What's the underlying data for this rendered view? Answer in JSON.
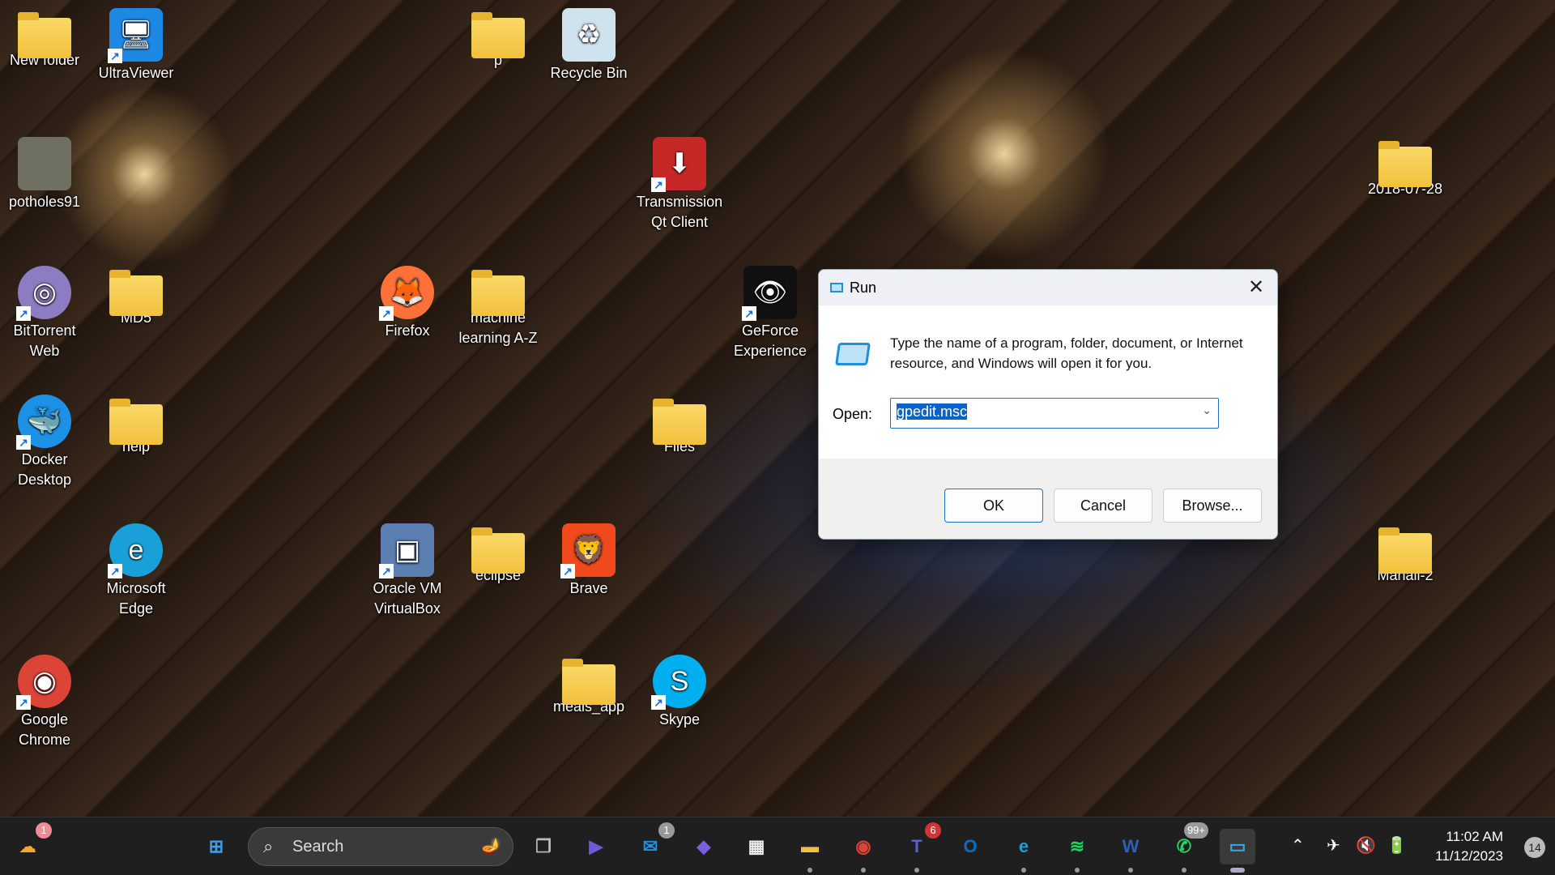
{
  "desktop": {
    "icons": [
      {
        "label": "New folder",
        "type": "folder",
        "col": 0,
        "row": 0
      },
      {
        "label": "UltraViewer",
        "type": "app",
        "icon": "ultraviewer-icon",
        "color": "#1e88e5",
        "glyph": "🖥",
        "shortcut": true,
        "col": 1,
        "row": 0
      },
      {
        "label": "p",
        "type": "folder",
        "col": 4,
        "row": 0
      },
      {
        "label": "Recycle Bin",
        "type": "app",
        "icon": "recycle-bin-icon",
        "color": "#cfe3ef",
        "glyph": "♻",
        "col": 5,
        "row": 0
      },
      {
        "label": "potholes91",
        "type": "app",
        "icon": "image-thumbnail-icon",
        "color": "#6f6f62",
        "glyph": "",
        "col": 0,
        "row": 1
      },
      {
        "label": "Transmission Qt Client",
        "type": "app",
        "icon": "transmission-icon",
        "color": "#c62828",
        "glyph": "⬇",
        "shortcut": true,
        "col": 6,
        "row": 1
      },
      {
        "label": "2018-07-28",
        "type": "folder",
        "col": 9,
        "row": 1
      },
      {
        "label": "BitTorrent Web",
        "type": "app",
        "icon": "bittorrent-icon",
        "color": "#8e7cc3",
        "glyph": "◎",
        "shortcut": true,
        "col": 0,
        "row": 2,
        "round": true
      },
      {
        "label": "MD5",
        "type": "folder",
        "col": 1,
        "row": 2
      },
      {
        "label": "Firefox",
        "type": "app",
        "icon": "firefox-icon",
        "color": "#ff7139",
        "glyph": "🦊",
        "shortcut": true,
        "col": 3,
        "row": 2,
        "round": true
      },
      {
        "label": "machine learning A-Z",
        "type": "folder",
        "col": 4,
        "row": 2
      },
      {
        "label": "GeForce Experience",
        "type": "app",
        "icon": "geforce-icon",
        "color": "#111",
        "glyph": "👁",
        "shortcut": true,
        "col": 7,
        "row": 2
      },
      {
        "label": "Docker Desktop",
        "type": "app",
        "icon": "docker-icon",
        "color": "#1d91e6",
        "glyph": "🐳",
        "shortcut": true,
        "col": 0,
        "row": 3,
        "round": true
      },
      {
        "label": "help",
        "type": "folder",
        "col": 1,
        "row": 3
      },
      {
        "label": "Files",
        "type": "folder",
        "col": 6,
        "row": 3
      },
      {
        "label": "Microsoft Edge",
        "type": "app",
        "icon": "edge-icon",
        "color": "#1aa0d8",
        "glyph": "e",
        "shortcut": true,
        "col": 1,
        "row": 4,
        "round": true
      },
      {
        "label": "Oracle VM VirtualBox",
        "type": "app",
        "icon": "virtualbox-icon",
        "color": "#5a7fb0",
        "glyph": "▣",
        "shortcut": true,
        "col": 3,
        "row": 4
      },
      {
        "label": "eclipse",
        "type": "folder",
        "col": 4,
        "row": 4
      },
      {
        "label": "Brave",
        "type": "app",
        "icon": "brave-icon",
        "color": "#f04a1c",
        "glyph": "🦁",
        "shortcut": true,
        "col": 5,
        "row": 4
      },
      {
        "label": "Manali-2",
        "type": "folder",
        "col": 9,
        "row": 4
      },
      {
        "label": "Google Chrome",
        "type": "app",
        "icon": "chrome-icon",
        "color": "#db4437",
        "glyph": "◉",
        "shortcut": true,
        "col": 0,
        "row": 5,
        "round": true
      },
      {
        "label": "meals_app",
        "type": "folder",
        "col": 5,
        "row": 5
      },
      {
        "label": "Skype",
        "type": "app",
        "icon": "skype-icon",
        "color": "#00aff0",
        "glyph": "S",
        "shortcut": true,
        "col": 6,
        "row": 5,
        "round": true
      }
    ]
  },
  "run_dialog": {
    "title": "Run",
    "description": "Type the name of a program, folder, document, or Internet resource, and Windows will open it for you.",
    "open_label": "Open:",
    "open_value": "gpedit.msc",
    "ok": "OK",
    "cancel": "Cancel",
    "browse": "Browse..."
  },
  "taskbar": {
    "search_placeholder": "Search",
    "weather_badge": "1",
    "apps": [
      {
        "name": "start-button",
        "glyph": "⊞",
        "color": "#3aa0f0"
      },
      {
        "name": "task-view",
        "glyph": "❐",
        "color": "#bbb"
      },
      {
        "name": "meet-now",
        "glyph": "▶",
        "color": "#6b5bd6"
      },
      {
        "name": "mail",
        "glyph": "✉",
        "color": "#1f8fe0",
        "badge": "1"
      },
      {
        "name": "copilot",
        "glyph": "◆",
        "color": "#7a5de0"
      },
      {
        "name": "microsoft-store",
        "glyph": "▦",
        "color": "#eee"
      },
      {
        "name": "file-explorer",
        "glyph": "▬",
        "color": "#f2c13c",
        "running": true
      },
      {
        "name": "chrome",
        "glyph": "◉",
        "color": "#db4437",
        "running": true
      },
      {
        "name": "teams",
        "glyph": "T",
        "color": "#5b5fc7",
        "badge": "6",
        "badge_color": "#d13438",
        "running": true
      },
      {
        "name": "outlook",
        "glyph": "O",
        "color": "#0f6cbd"
      },
      {
        "name": "edge",
        "glyph": "e",
        "color": "#1aa0d8",
        "running": true
      },
      {
        "name": "spotify",
        "glyph": "≋",
        "color": "#1ed760",
        "running": true
      },
      {
        "name": "word",
        "glyph": "W",
        "color": "#2b5fb8",
        "running": true
      },
      {
        "name": "whatsapp",
        "glyph": "✆",
        "color": "#25d366",
        "badge": "99+",
        "running": true
      },
      {
        "name": "run",
        "glyph": "▭",
        "color": "#3aa8e8",
        "active": true
      }
    ],
    "time": "11:02 AM",
    "date": "11/12/2023",
    "notification_count": "14"
  }
}
